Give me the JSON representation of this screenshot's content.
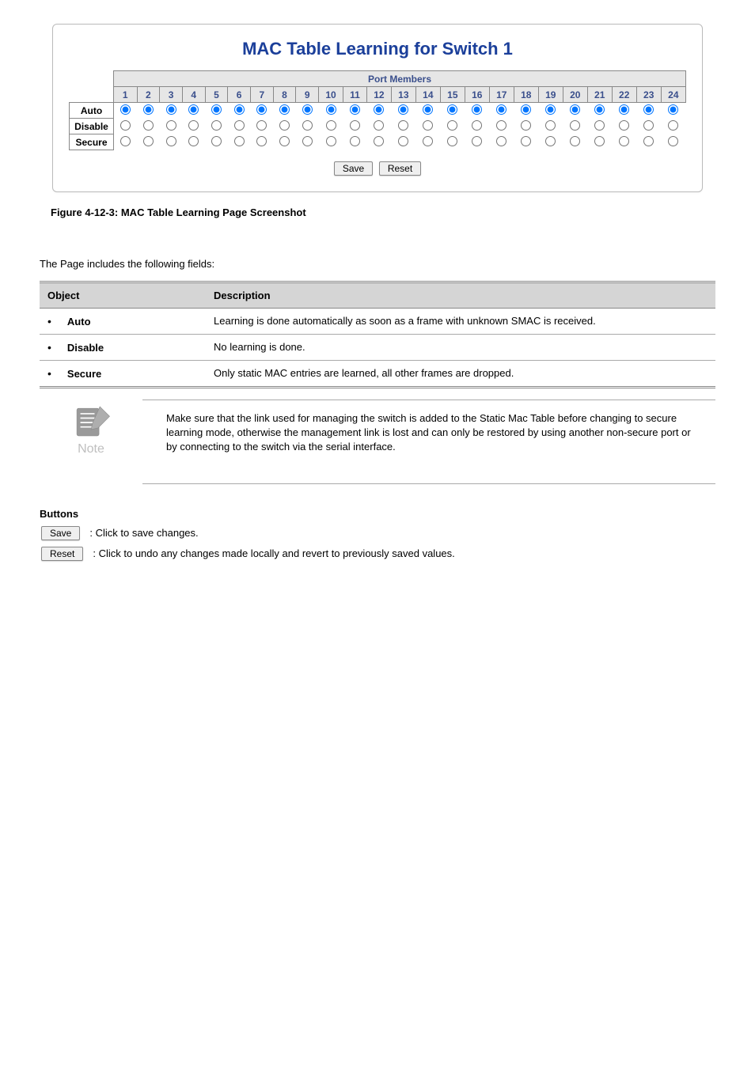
{
  "panel": {
    "title": "MAC Table Learning for Switch 1",
    "port_members_header": "Port Members",
    "ports": [
      1,
      2,
      3,
      4,
      5,
      6,
      7,
      8,
      9,
      10,
      11,
      12,
      13,
      14,
      15,
      16,
      17,
      18,
      19,
      20,
      21,
      22,
      23,
      24
    ],
    "rows": [
      {
        "label": "Auto",
        "selected_for_all": true
      },
      {
        "label": "Disable",
        "selected_for_all": false
      },
      {
        "label": "Secure",
        "selected_for_all": false
      }
    ],
    "save_label": "Save",
    "reset_label": "Reset"
  },
  "figure_caption": "Figure 4-12-3: MAC Table Learning Page Screenshot",
  "obj_table": {
    "col_object": "Object",
    "col_desc": "Description",
    "rows": [
      {
        "name": "Auto",
        "desc": "Learning is done automatically as soon as a frame with unknown SMAC is received."
      },
      {
        "name": "Disable",
        "desc": "No learning is done."
      },
      {
        "name": "Secure",
        "desc": "Only static MAC entries are learned, all other frames are dropped."
      }
    ]
  },
  "note": {
    "label": "Note",
    "text": "Make sure that the link used for managing the switch is added to the Static Mac Table before changing to secure learning mode, otherwise the management link is lost and can only be restored by using another non-secure port or by connecting to the switch via the serial interface."
  },
  "buttons_heading": "Buttons",
  "buttons": [
    {
      "label": "Save",
      "desc": ": Click to save changes."
    },
    {
      "label": "Reset",
      "desc": ": Click to undo any changes made locally and revert to previously saved values."
    }
  ]
}
